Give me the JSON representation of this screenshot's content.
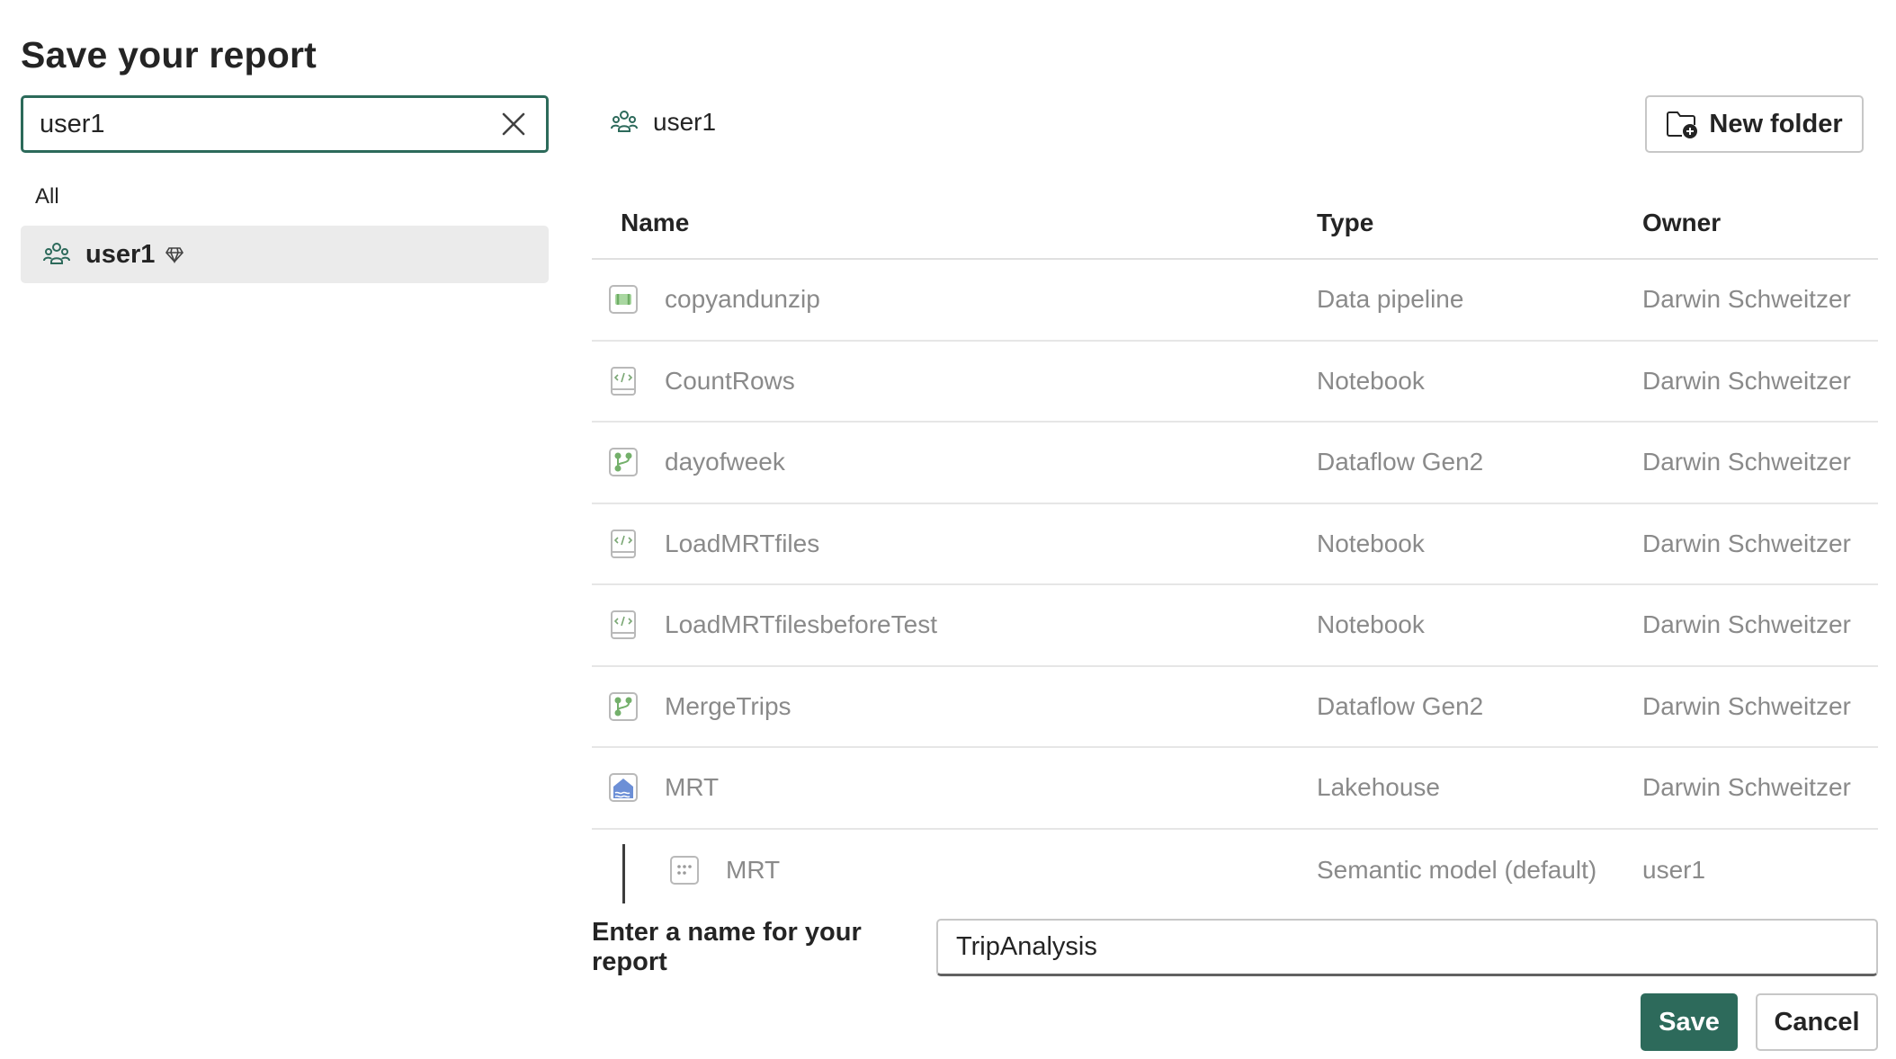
{
  "dialog": {
    "title": "Save your report"
  },
  "search": {
    "value": "user1"
  },
  "filter": {
    "label": "All"
  },
  "workspace_list": [
    {
      "label": "user1",
      "icon": "workspace-icon",
      "badge_icon": "premium-diamond-icon",
      "selected": true
    }
  ],
  "breadcrumb": {
    "label": "user1",
    "icon": "workspace-icon"
  },
  "toolbar": {
    "new_folder_label": "New folder",
    "new_folder_icon": "folder-add-icon"
  },
  "table": {
    "columns": [
      "Name",
      "Type",
      "Owner"
    ],
    "rows": [
      {
        "name": "copyandunzip",
        "type": "Data pipeline",
        "owner": "Darwin Schweitzer",
        "icon": "data-pipeline-icon"
      },
      {
        "name": "CountRows",
        "type": "Notebook",
        "owner": "Darwin Schweitzer",
        "icon": "notebook-icon"
      },
      {
        "name": "dayofweek",
        "type": "Dataflow Gen2",
        "owner": "Darwin Schweitzer",
        "icon": "dataflow-icon"
      },
      {
        "name": "LoadMRTfiles",
        "type": "Notebook",
        "owner": "Darwin Schweitzer",
        "icon": "notebook-icon"
      },
      {
        "name": "LoadMRTfilesbeforeTest",
        "type": "Notebook",
        "owner": "Darwin Schweitzer",
        "icon": "notebook-icon"
      },
      {
        "name": "MergeTrips",
        "type": "Dataflow Gen2",
        "owner": "Darwin Schweitzer",
        "icon": "dataflow-icon"
      },
      {
        "name": "MRT",
        "type": "Lakehouse",
        "owner": "Darwin Schweitzer",
        "icon": "lakehouse-icon"
      },
      {
        "name": "MRT",
        "type": "Semantic model (default)",
        "owner": "user1",
        "icon": "semantic-model-icon",
        "child": true
      }
    ]
  },
  "report_name": {
    "label": "Enter a name for your report",
    "value": "TripAnalysis"
  },
  "actions": {
    "save_label": "Save",
    "cancel_label": "Cancel"
  },
  "colors": {
    "accent": "#2d6a5b",
    "muted_text": "#8a8a8a",
    "selected_bg": "#ebebeb"
  }
}
